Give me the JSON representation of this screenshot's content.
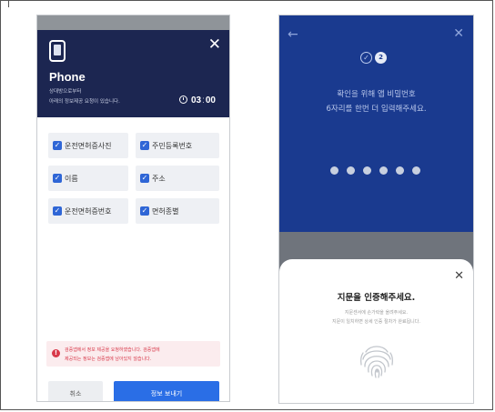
{
  "left_screen": {
    "title": "Phone",
    "subtitle_line1": "상대방으로부터",
    "subtitle_line2": "아래의 정보제공 요청이 있습니다.",
    "timer_minutes": "03",
    "timer_seconds": "00",
    "checkboxes": [
      {
        "label": "운전면허증사진",
        "checked": true
      },
      {
        "label": "주민등록번호",
        "checked": true
      },
      {
        "label": "이름",
        "checked": true
      },
      {
        "label": "주소",
        "checked": true
      },
      {
        "label": "운전면허증번호",
        "checked": true
      },
      {
        "label": "면허종별",
        "checked": true
      }
    ],
    "warning_line1": "검증앱에서 정보 제공을 요청하였습니다. 검증앱에",
    "warning_line2": "제공되는 정보는 검증앱에 남아있지 않습니다.",
    "cancel_label": "취소",
    "send_label": "정보 보내기"
  },
  "right_screen": {
    "step_current": "2",
    "message_line1": "확인을 위해 앱 비밀번호",
    "message_line2": "6자리를 한번 더 입력해주세요.",
    "pin_filled": 6,
    "sheet_title": "지문을 인증해주세요.",
    "sheet_desc1": "지문센서에 손가락을 올려주세요.",
    "sheet_desc2": "지문이 일치하면 상세 인증 절차가 완료됩니다."
  },
  "colors": {
    "header_navy": "#1c2651",
    "accent_blue": "#2a6ee6",
    "right_bg": "#1a3a8f",
    "warning_red": "#d8394a"
  },
  "icons": [
    "phone-icon",
    "close-icon",
    "clock-icon",
    "checkbox-icon",
    "alert-icon",
    "back-arrow-icon",
    "check-icon",
    "fingerprint-icon"
  ]
}
